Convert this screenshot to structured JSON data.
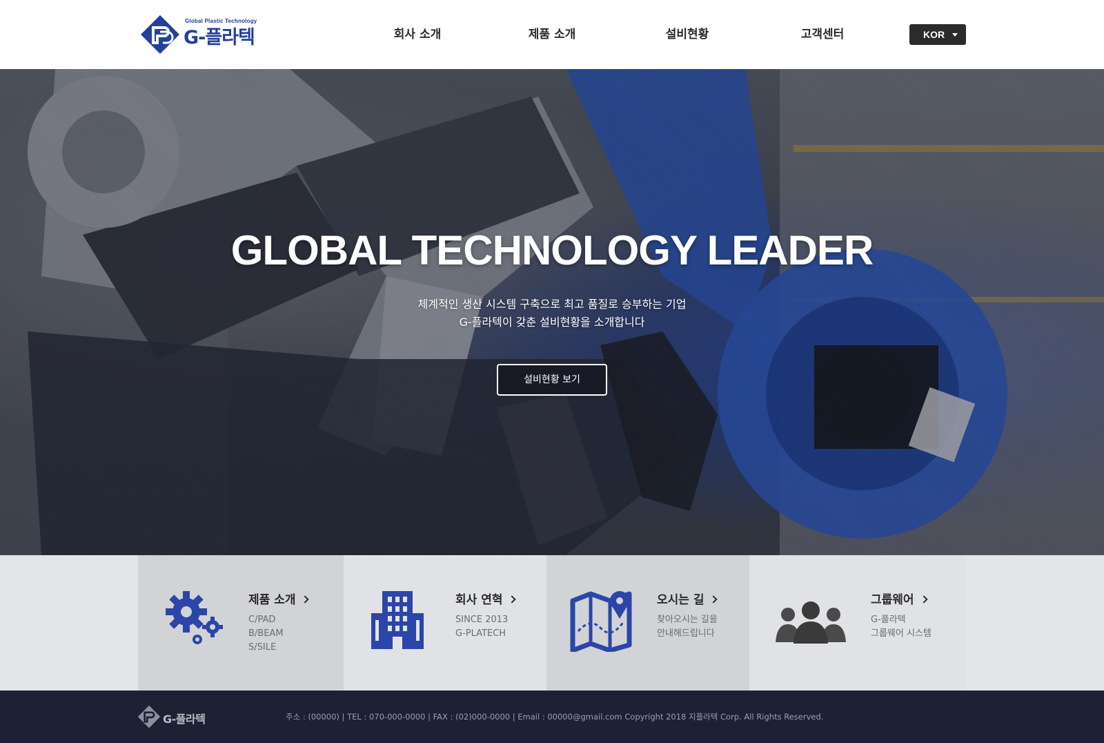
{
  "header": {
    "logo_tagline": "Global Plastic Technology",
    "logo_name": "G-플라텍",
    "nav": [
      "회사 소개",
      "제품 소개",
      "설비현황",
      "고객센터"
    ],
    "language": "KOR"
  },
  "hero": {
    "title": "GLOBAL TECHNOLOGY LEADER",
    "subtitle_line1": "체계적인 생산 시스템 구축으로 최고 품질로 승부하는 기업",
    "subtitle_line2": "G-플라텍이 갖춘 설비현황을 소개합니다",
    "button_label": "설비현황 보기"
  },
  "quick_links": [
    {
      "title": "제품 소개",
      "lines": [
        "C/PAD",
        "B/BEAM",
        "S/SILE"
      ],
      "icon": "gears-icon"
    },
    {
      "title": "회사 연혁",
      "lines": [
        "SINCE 2013",
        "G-PLATECH"
      ],
      "icon": "building-icon"
    },
    {
      "title": "오시는 길",
      "lines": [
        "찾아오시는 길을",
        "안내해드립니다"
      ],
      "icon": "map-icon"
    },
    {
      "title": "그룹웨어",
      "lines": [
        "G-플라텍",
        "그룹웨어 시스템"
      ],
      "icon": "group-icon"
    }
  ],
  "footer": {
    "logo_name": "G-플라텍",
    "info": "주소 : (00000)  |   TEL : 070-000-0000   |   FAX : (02)000-0000  |  Email : 00000@gmail.com  Copyright 2018 지플라텍 Corp. All Rights Reserved."
  },
  "colors": {
    "brand_blue": "#23409c",
    "footer_bg": "#1c2133",
    "quick_bg": "#e4e5e8",
    "icon_blue": "#2b46a8",
    "icon_gray": "#4a4a4a"
  }
}
